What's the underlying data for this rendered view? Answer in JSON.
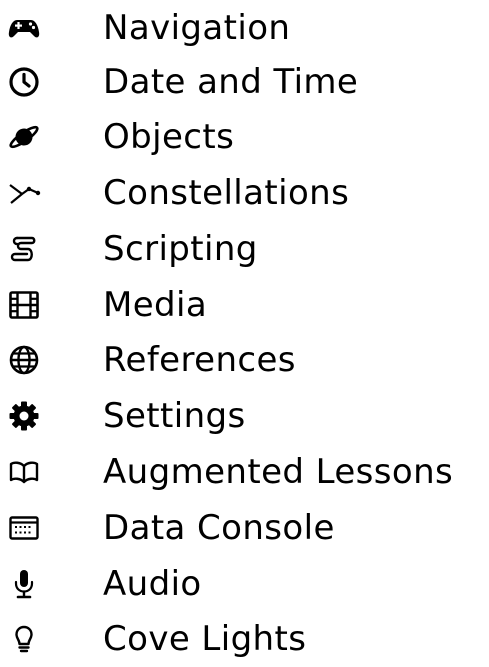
{
  "menu": {
    "items": [
      {
        "icon": "gamepad-icon",
        "label": "Navigation"
      },
      {
        "icon": "clock-icon",
        "label": "Date and Time"
      },
      {
        "icon": "planet-icon",
        "label": "Objects"
      },
      {
        "icon": "constellation-icon",
        "label": "Constellations"
      },
      {
        "icon": "scroll-icon",
        "label": "Scripting"
      },
      {
        "icon": "film-icon",
        "label": "Media"
      },
      {
        "icon": "globe-icon",
        "label": "References"
      },
      {
        "icon": "gear-icon",
        "label": "Settings"
      },
      {
        "icon": "book-open-icon",
        "label": "Augmented Lessons"
      },
      {
        "icon": "console-icon",
        "label": "Data Console"
      },
      {
        "icon": "microphone-icon",
        "label": "Audio"
      },
      {
        "icon": "lightbulb-icon",
        "label": "Cove Lights"
      }
    ]
  }
}
